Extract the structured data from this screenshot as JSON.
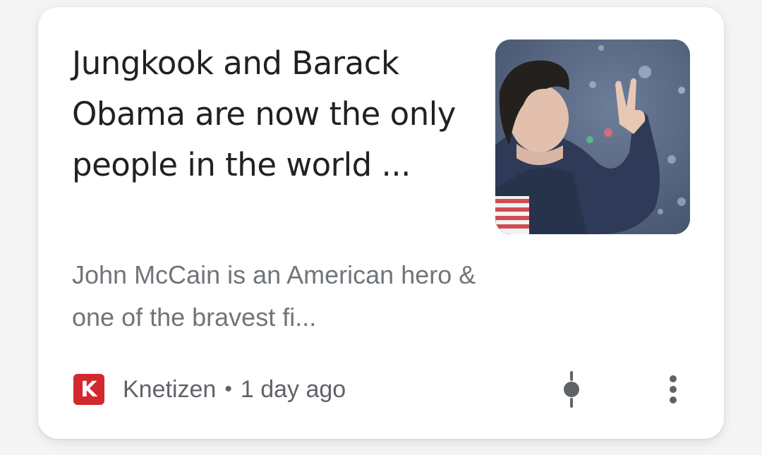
{
  "card": {
    "headline": "Jungkook and Barack Obama are now the only people in the world ...",
    "snippet": "John McCain is an American hero & one of the bravest fi...",
    "source": {
      "logo_letter": "K",
      "logo_color": "#d2282f",
      "name": "Knetizen",
      "separator": "•",
      "time": "1 day ago"
    },
    "thumbnail": {
      "description": "person-in-denim-jacket-icon"
    },
    "actions": {
      "follow_icon": "follow-icon",
      "more_icon": "more-vertical-icon"
    }
  }
}
